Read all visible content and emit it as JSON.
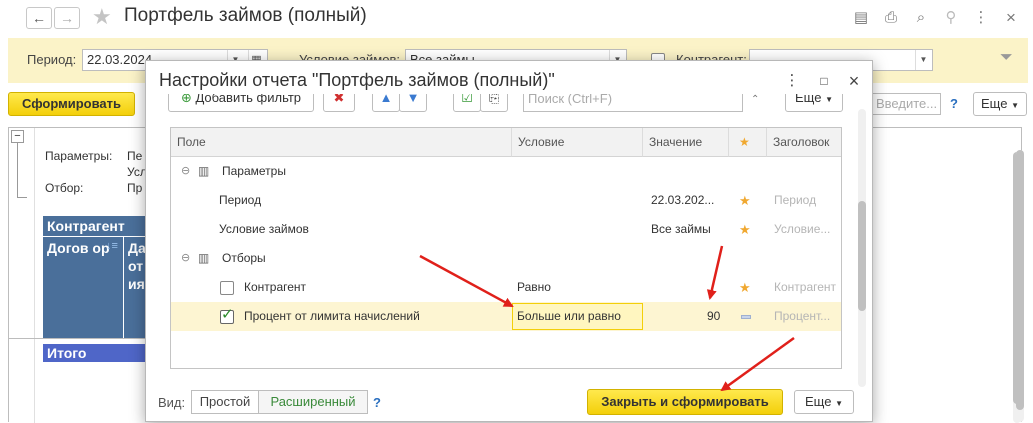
{
  "window": {
    "title": "Портфель займов (полный)",
    "back_icon": "←",
    "forward_icon": "→",
    "star_icon": "★",
    "tool_icons": [
      "▤",
      "⎙",
      "⌕",
      "⚲",
      "⋮",
      "×"
    ]
  },
  "filters": {
    "period_label": "Период:",
    "period_value": "22.03.2024",
    "conditions_label": "Условие займов:",
    "conditions_value": "Все займы",
    "counterparty_label": "Контрагент:",
    "counterparty_value": ""
  },
  "toolbar": {
    "generate_label": "Сформировать",
    "search_placeholder": "Введите...",
    "help": "?",
    "more_label": "Еще"
  },
  "report": {
    "params_label": "Параметры:",
    "params_value_1": "Пе",
    "params_value_2": "Усл",
    "filter_label": "Отбор:",
    "filter_value": "Пр",
    "counterparty_header": "Контрагент",
    "contract_header": "Догов ор",
    "col_partial": "Да от ия",
    "total_label": "Итого"
  },
  "dialog": {
    "title": "Настройки отчета \"Портфель займов (полный)\"",
    "add_filter_label": "Добавить фильтр",
    "search_placeholder": "Поиск (Ctrl+F)",
    "more_label": "Еще",
    "columns": [
      "Поле",
      "Условие",
      "Значение",
      "★",
      "Заголовок"
    ],
    "groups": [
      {
        "label": "Параметры",
        "rows": [
          {
            "field": "Период",
            "condition": "",
            "value": "22.03.202...",
            "title": "Период"
          },
          {
            "field": "Условие займов",
            "condition": "",
            "value": "Все займы",
            "title": "Условие..."
          }
        ]
      },
      {
        "label": "Отборы",
        "rows": [
          {
            "field": "Контрагент",
            "condition": "Равно",
            "value": "",
            "title": "Контрагент",
            "checked": false
          },
          {
            "field": "Процент от лимита начислений",
            "condition": "Больше или равно",
            "value": "90",
            "title": "Процент...",
            "checked": true
          }
        ]
      }
    ],
    "view_label": "Вид:",
    "view_simple": "Простой",
    "view_extended": "Расширенный",
    "help": "?",
    "close_generate_label": "Закрыть и сформировать",
    "more_bottom_label": "Еще"
  },
  "colors": {
    "accent_yellow": "#f3cf0a",
    "band": "#fbf3c8",
    "selected_row": "#fdf5d2",
    "header_blue": "#4a6f9a",
    "total_blue": "#4f66c8",
    "arrow_red": "#e0201a"
  }
}
